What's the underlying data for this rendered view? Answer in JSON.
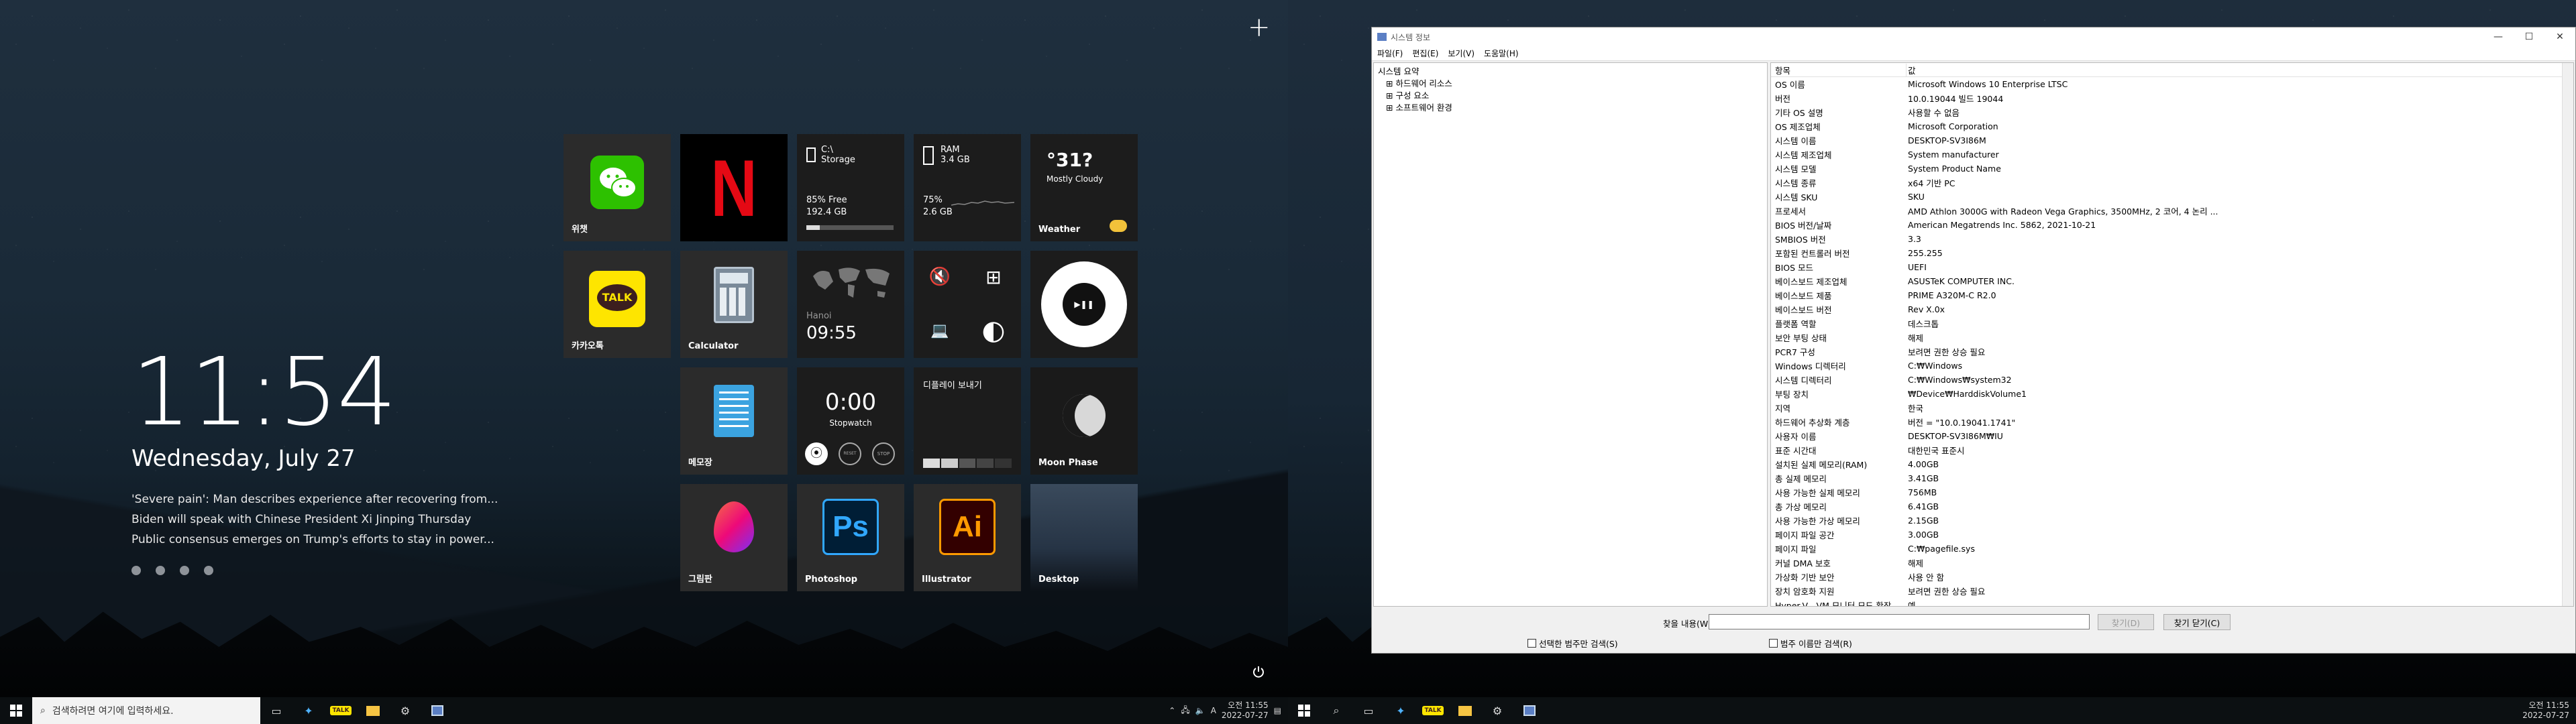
{
  "left": {
    "clock": {
      "time": "11:54",
      "date": "Wednesday, July 27"
    },
    "news": [
      "'Severe pain': Man describes experience after recovering from...",
      "Biden will speak with Chinese President Xi Jinping Thursday",
      "Public consensus emerges on Trump's efforts to stay in power..."
    ],
    "tiles": {
      "wechat": {
        "label": "위챗"
      },
      "netflix": {
        "glyph": "N"
      },
      "storage": {
        "drive": "C:\\",
        "title": "Storage",
        "free": "85% Free",
        "size": "192.4 GB",
        "fill_percent": 15
      },
      "ram": {
        "title": "RAM",
        "total": "3.4 GB",
        "used_percent": "75%",
        "used": "2.6 GB"
      },
      "weather": {
        "temp": "°31?",
        "cond": "Mostly Cloudy",
        "label": "Weather"
      },
      "kakaotalk": {
        "badge": "TALK",
        "label": "카카오톡"
      },
      "calculator": {
        "label": "Calculator"
      },
      "worldclock": {
        "city": "Hanoi",
        "time": "09:55"
      },
      "quicktools": {
        "speaker": "🔇",
        "windows": "⊞",
        "laptop": "💻",
        "toggle": "◐"
      },
      "music": {
        "play": "▶❚❚"
      },
      "memo": {
        "label": "메모장"
      },
      "stopwatch": {
        "time": "0:00",
        "title": "Stopwatch",
        "b1": "⦿",
        "b2": "RESET",
        "b3": "STOP"
      },
      "display": {
        "label": "디플레이 보내기"
      },
      "moon": {
        "label": "Moon Phase"
      },
      "grimpan": {
        "label": "그림판"
      },
      "photoshop": {
        "glyph": "Ps",
        "label": "Photoshop"
      },
      "illustrator": {
        "glyph": "Ai",
        "label": "Illustrator"
      },
      "desktop": {
        "label": "Desktop"
      }
    },
    "taskbar": {
      "search_placeholder": "검색하려면 여기에 입력하세요.",
      "time": "오전 11:55",
      "date": "2022-07-27",
      "ime": "A"
    }
  },
  "sysinfo": {
    "title": "시스템 정보",
    "menu": [
      "파일(F)",
      "편집(E)",
      "보기(V)",
      "도움말(H)"
    ],
    "tree": {
      "root": "시스템 요약",
      "children": [
        "하드웨어 리소스",
        "구성 요소",
        "소프트웨어 환경"
      ]
    },
    "columns": {
      "item": "항목",
      "value": "값"
    },
    "rows": [
      [
        "OS 이름",
        "Microsoft Windows 10 Enterprise LTSC"
      ],
      [
        "버전",
        "10.0.19044 빌드 19044"
      ],
      [
        "기타 OS 설명",
        "사용할 수 없음"
      ],
      [
        "OS 제조업체",
        "Microsoft Corporation"
      ],
      [
        "시스템 이름",
        "DESKTOP-SV3I86M"
      ],
      [
        "시스템 제조업체",
        "System manufacturer"
      ],
      [
        "시스템 모델",
        "System Product Name"
      ],
      [
        "시스템 종류",
        "x64 기반 PC"
      ],
      [
        "시스템 SKU",
        "SKU"
      ],
      [
        "프로세서",
        "AMD Athlon 3000G with Radeon Vega Graphics, 3500MHz, 2 코어, 4 논리 ..."
      ],
      [
        "BIOS 버전/날짜",
        "American Megatrends Inc. 5862, 2021-10-21"
      ],
      [
        "SMBIOS 버전",
        "3.3"
      ],
      [
        "포함된 컨트롤러 버전",
        "255.255"
      ],
      [
        "BIOS 모드",
        "UEFI"
      ],
      [
        "베이스보드 제조업체",
        "ASUSTeK COMPUTER INC."
      ],
      [
        "베이스보드 제품",
        "PRIME A320M-C R2.0"
      ],
      [
        "베이스보드 버전",
        "Rev X.0x"
      ],
      [
        "플랫폼 역할",
        "데스크톱"
      ],
      [
        "보안 부팅 상태",
        "해제"
      ],
      [
        "PCR7 구성",
        "보려면 권한 상승 필요"
      ],
      [
        "Windows 디렉터리",
        "C:₩Windows"
      ],
      [
        "시스템 디렉터리",
        "C:₩Windows₩system32"
      ],
      [
        "부팅 장치",
        "₩Device₩HarddiskVolume1"
      ],
      [
        "지역",
        "한국"
      ],
      [
        "하드웨어 추상화 계층",
        "버전 = \"10.0.19041.1741\""
      ],
      [
        "사용자 이름",
        "DESKTOP-SV3I86M₩IU"
      ],
      [
        "표준 시간대",
        "대한민국 표준시"
      ],
      [
        "설치된 실제 메모리(RAM)",
        "4.00GB"
      ],
      [
        "총 실제 메모리",
        "3.41GB"
      ],
      [
        "사용 가능한 실제 메모리",
        "756MB"
      ],
      [
        "총 가상 메모리",
        "6.41GB"
      ],
      [
        "사용 가능한 가상 메모리",
        "2.15GB"
      ],
      [
        "페이지 파일 공간",
        "3.00GB"
      ],
      [
        "페이지 파일",
        "C:₩pagefile.sys"
      ],
      [
        "커널 DMA 보호",
        "해제"
      ],
      [
        "가상화 기반 보안",
        "사용 안 함"
      ],
      [
        "장치 암호화 지원",
        "보려면 권한 상승 필요"
      ],
      [
        "Hyper-V - VM 모니터 모드 확장",
        "예"
      ]
    ],
    "find": {
      "label": "찾을 내용(W):",
      "find_button": "찾기(D)",
      "close_button": "찾기 닫기(C)",
      "opt1": "선택한 범주만 검색(S)",
      "opt2": "범주 이름만 검색(R)"
    }
  },
  "right_taskbar": {
    "time": "오전 11:55",
    "date": "2022-07-27"
  }
}
